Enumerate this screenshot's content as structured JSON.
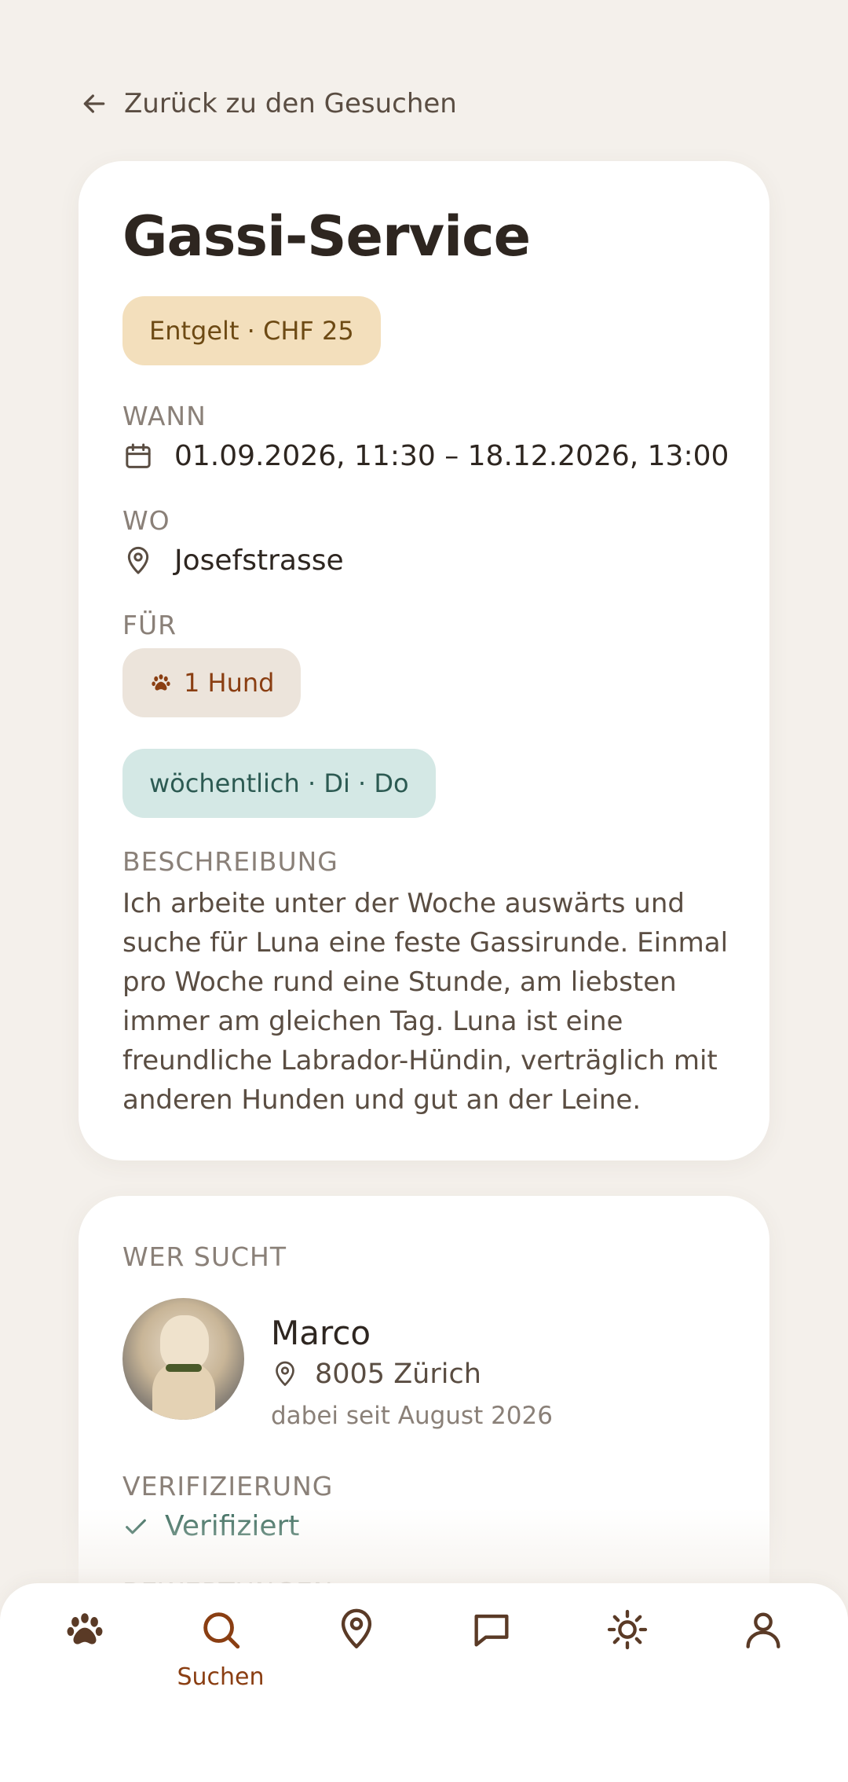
{
  "back_link": {
    "label": "Zurück zu den Gesuchen"
  },
  "request": {
    "title": "Gassi-Service",
    "price_badge": "Entgelt · CHF 25",
    "when_label": "WANN",
    "when_value": "01.09.2026, 11:30 – 18.12.2026, 13:00",
    "where_label": "WO",
    "where_value": "Josefstrasse",
    "for_label": "FÜR",
    "for_badge": "1 Hund",
    "frequency_badge": "wöchentlich · Di · Do",
    "description_label": "BESCHREIBUNG",
    "description": "Ich arbeite unter der Woche auswärts und suche für Luna eine feste Gassirunde. Einmal pro Woche rund eine Stunde, am liebsten immer am gleichen Tag. Luna ist eine freundliche Labrador-Hündin, verträglich mit anderen Hunden und gut an der Leine."
  },
  "seeker": {
    "section_label": "WER SUCHT",
    "name": "Marco",
    "location": "8005 Zürich",
    "member_since": "dabei seit August 2026",
    "verification_label": "VERIFIZIERUNG",
    "verification_status": "Verifiziert",
    "next_section_label": "BEWERTUNGEN"
  },
  "nav": {
    "items": [
      {
        "icon": "paw-icon"
      },
      {
        "icon": "search-icon",
        "label": "Suchen",
        "active": true
      },
      {
        "icon": "location-icon"
      },
      {
        "icon": "chat-icon"
      },
      {
        "icon": "sun-icon"
      },
      {
        "icon": "profile-icon"
      }
    ]
  },
  "colors": {
    "background": "#f4f0eb",
    "accent": "#8a3e12",
    "price_badge_bg": "#f3dfbc",
    "frequency_badge_bg": "#d4e8e5",
    "verified": "#3f6e60"
  }
}
